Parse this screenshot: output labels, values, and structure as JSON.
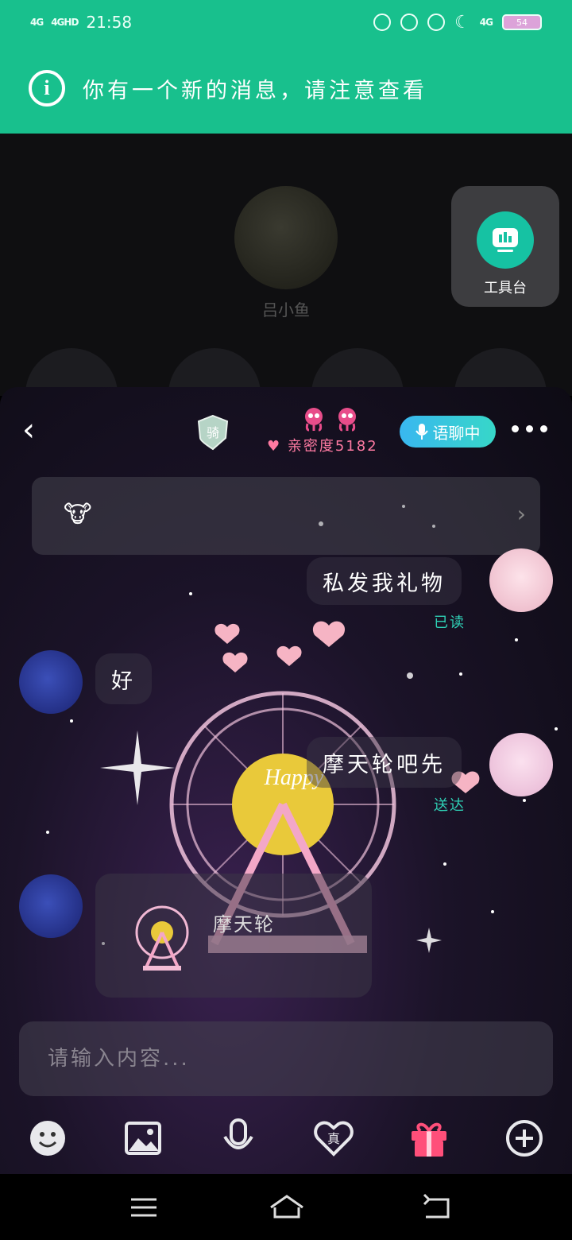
{
  "status_bar": {
    "signal_1": "4G",
    "signal_2": "4GHD",
    "time": "21:58",
    "network": "4G",
    "battery": "54"
  },
  "notice": {
    "text": "你有一个新的消息，请注意查看"
  },
  "room": {
    "host_name": "吕小鱼",
    "tool_label": "工具台"
  },
  "chat": {
    "badge_text": "骑",
    "intimacy_text": "亲密度5182",
    "voice_label": "语聊中",
    "banner_icon": "🐮",
    "messages": [
      {
        "side": "right",
        "text": "私发我礼物",
        "status": "已读"
      },
      {
        "side": "left",
        "text": "好"
      },
      {
        "side": "right",
        "text": "摩天轮吧先",
        "status": "送达"
      },
      {
        "side": "left",
        "gift_text": "摩天轮"
      }
    ],
    "input_placeholder": "请输入内容...",
    "toolbar": {
      "emoji": "emoji-icon",
      "image": "image-icon",
      "mic": "microphone-icon",
      "truth": "真",
      "gift": "gift-icon",
      "more": "plus-icon"
    }
  },
  "colors": {
    "notice_bg": "#18c08d",
    "accent": "#16c2a3",
    "intimacy": "#ff7aa2",
    "read_status": "#2fd1b6"
  }
}
